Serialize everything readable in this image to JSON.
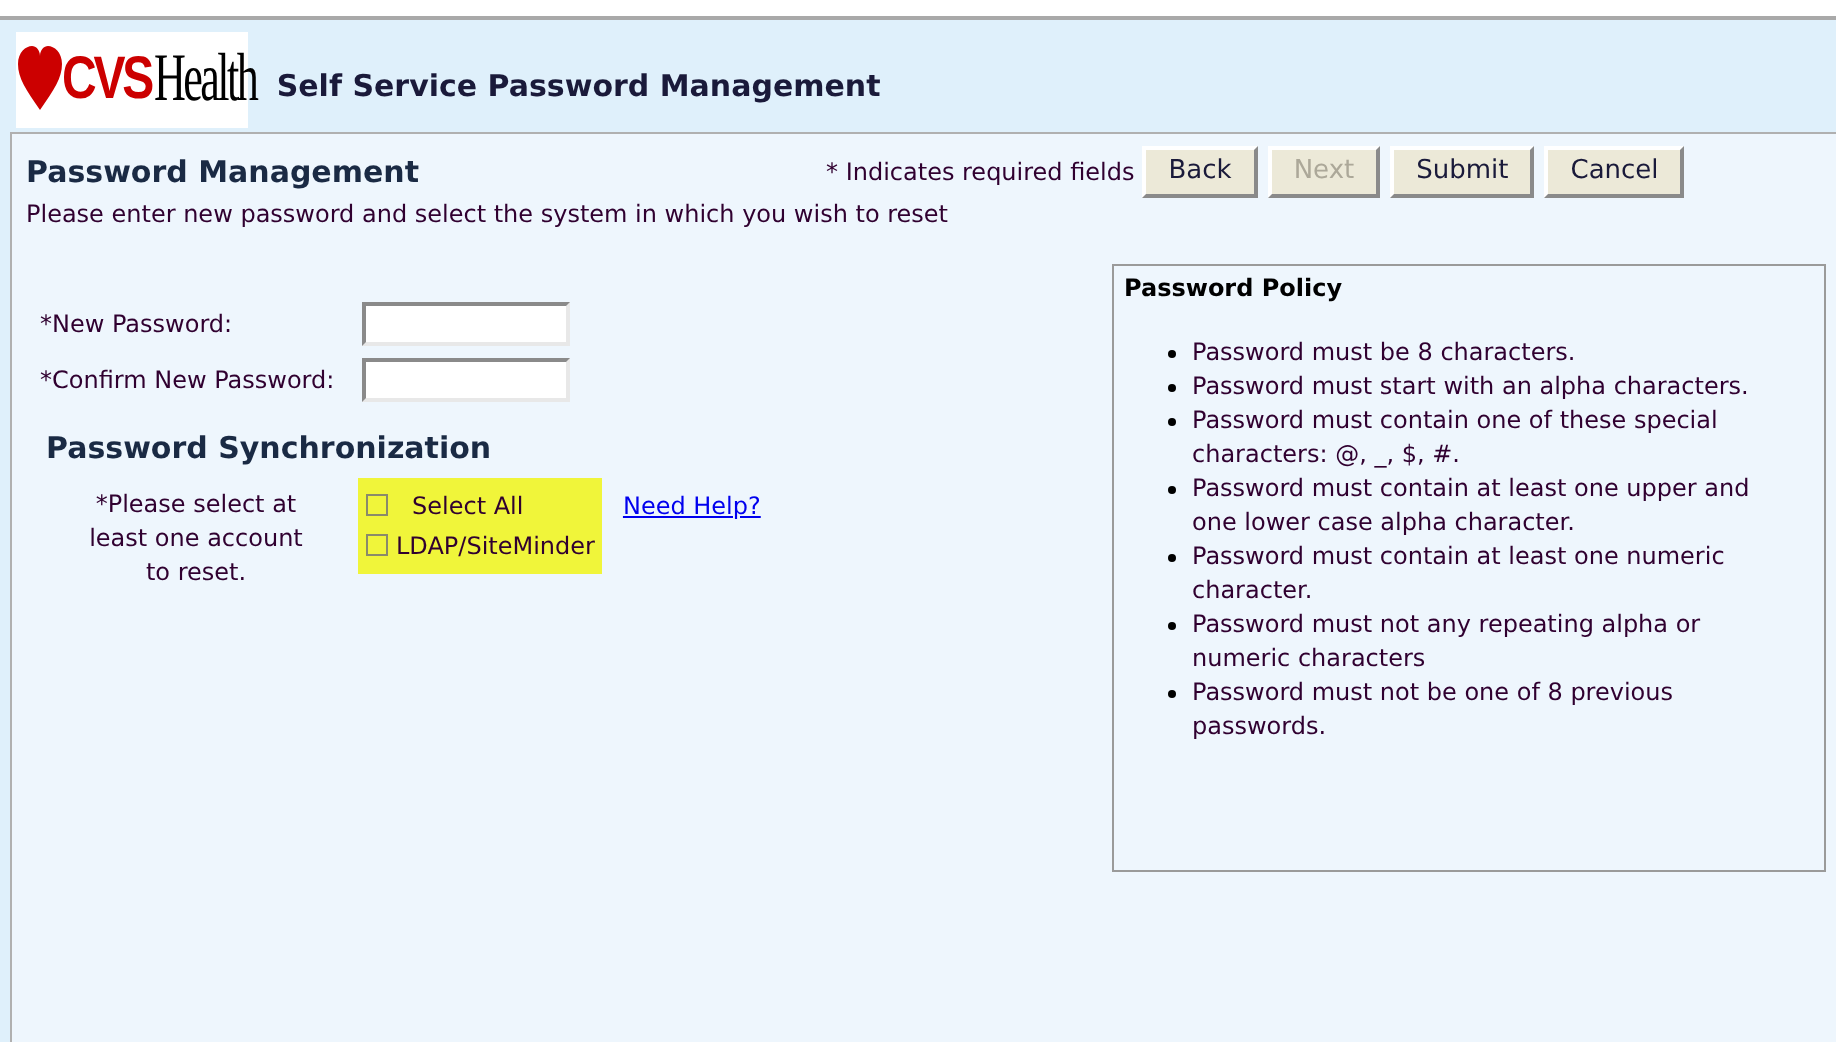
{
  "header": {
    "logo": {
      "brand": "CVS",
      "word": "Health"
    },
    "title": "Self Service Password Management"
  },
  "panel": {
    "title": "Password Management",
    "required_note": "* Indicates required fields",
    "instructions": "Please enter new password and select the system in which you wish to reset"
  },
  "buttons": [
    {
      "label": "Back",
      "disabled": false
    },
    {
      "label": "Next",
      "disabled": true
    },
    {
      "label": "Submit",
      "disabled": false
    },
    {
      "label": "Cancel",
      "disabled": false
    }
  ],
  "fields": [
    {
      "label": "*New Password:"
    },
    {
      "label": "*Confirm New Password:"
    }
  ],
  "sync": {
    "title": "Password Synchronization",
    "prompt": "*Please select at least one account to reset.",
    "options": [
      {
        "label": "Select All",
        "checked": false
      },
      {
        "label": "LDAP/SiteMinder",
        "checked": false
      }
    ],
    "help_link": "Need Help?"
  },
  "policy": {
    "title": "Password Policy",
    "rules": [
      "Password must be 8 characters.",
      "Password must start with an alpha characters.",
      "Password must contain one of these special characters: @, _, $, #.",
      "Password must contain at least one upper and one lower case alpha character.",
      "Password must contain at least one numeric character.",
      "Password must not any repeating alpha or numeric characters",
      "Password must not be one of 8 previous passwords."
    ]
  }
}
